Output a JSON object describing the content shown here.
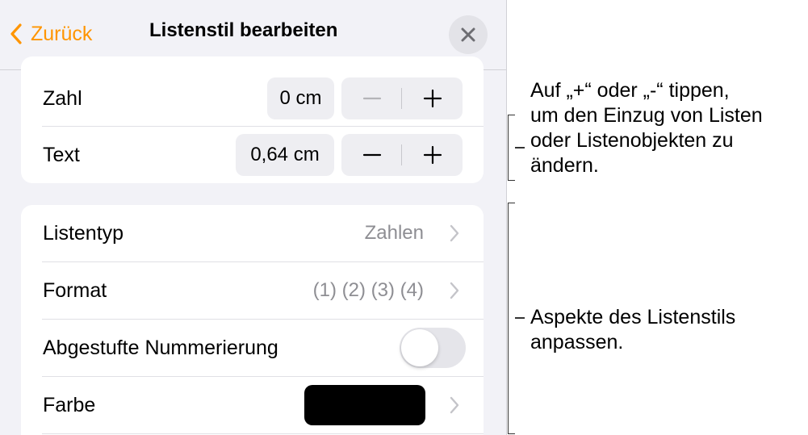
{
  "nav": {
    "back_label": "Zurück",
    "title": "Listenstil bearbeiten"
  },
  "indent": {
    "rows": [
      {
        "label": "Zahl",
        "value": "0 cm"
      },
      {
        "label": "Text",
        "value": "0,64 cm"
      }
    ]
  },
  "style": {
    "list_type_label": "Listentyp",
    "list_type_value": "Zahlen",
    "format_label": "Format",
    "format_value": "(1) (2) (3) (4)",
    "tiered_label": "Abgestufte Nummerierung",
    "tiered_on": false,
    "color_label": "Farbe",
    "color_value": "#000000"
  },
  "callouts": {
    "indent_text_line1": "Auf „+“ oder „-“ tippen,",
    "indent_text_line2": "um den Einzug von Listen",
    "indent_text_line3": "oder Listenobjekten zu",
    "indent_text_line4": "ändern.",
    "style_text_line1": "Aspekte des Listenstils",
    "style_text_line2": "anpassen."
  },
  "colors": {
    "accent": "#ff9500",
    "panel_bg": "#f2f2f7",
    "secondary_text": "#8e8e93"
  },
  "icons": {
    "back": "chevron-left-icon",
    "close": "close-icon",
    "minus": "minus-icon",
    "plus": "plus-icon",
    "disclosure": "chevron-right-icon"
  }
}
